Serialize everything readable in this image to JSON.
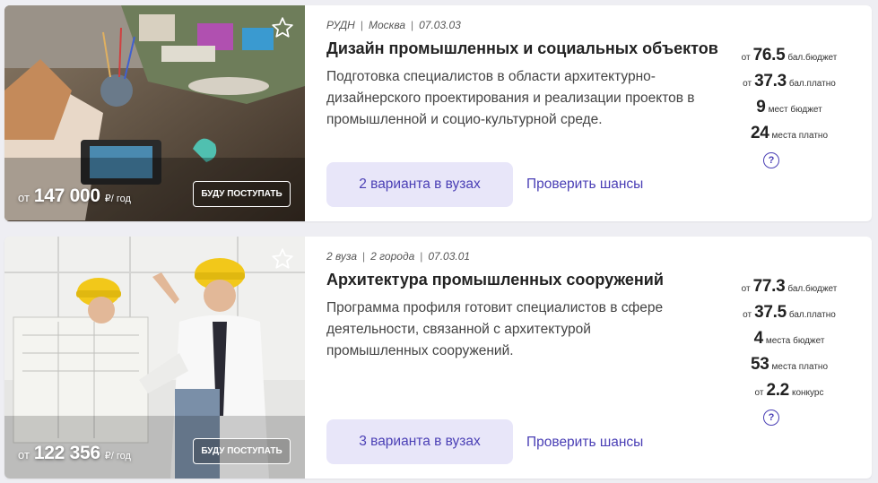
{
  "cards": [
    {
      "price_from": "от",
      "price_amount": "147 000",
      "price_unit": "₽/ год",
      "apply_label": "БУДУ ПОСТУПАТЬ",
      "meta": [
        "РУДН",
        "Москва",
        "07.03.03"
      ],
      "title": "Дизайн промышленных и социальных объектов",
      "description": "Подготовка специалистов в области архитектурно-дизайнерского проектирования и реализации проектов в промышленной и социо-культурной среде.",
      "variants_label": "2 варианта в вузах",
      "chances_label": "Проверить шансы",
      "stats": [
        {
          "pre": "от",
          "num": "76.5",
          "lbl": "бал.бюджет"
        },
        {
          "pre": "от",
          "num": "37.3",
          "lbl": "бал.платно"
        },
        {
          "pre": "",
          "num": "9",
          "lbl": "мест бюджет"
        },
        {
          "pre": "",
          "num": "24",
          "lbl": "места платно"
        }
      ],
      "help": "?"
    },
    {
      "price_from": "от",
      "price_amount": "122 356",
      "price_unit": "₽/ год",
      "apply_label": "БУДУ ПОСТУПАТЬ",
      "meta": [
        "2 вуза",
        "2 города",
        "07.03.01"
      ],
      "title": "Архитектура промышленных сооружений",
      "description": "Программа профиля готовит специалистов в сфере деятельности, связанной с архитектурой промышленных сооружений.",
      "variants_label": "3 варианта в вузах",
      "chances_label": "Проверить шансы",
      "stats": [
        {
          "pre": "от",
          "num": "77.3",
          "lbl": "бал.бюджет"
        },
        {
          "pre": "от",
          "num": "37.5",
          "lbl": "бал.платно"
        },
        {
          "pre": "",
          "num": "4",
          "lbl": "места бюджет"
        },
        {
          "pre": "",
          "num": "53",
          "lbl": "места платно"
        },
        {
          "pre": "от",
          "num": "2.2",
          "lbl": "конкурс"
        }
      ],
      "help": "?"
    }
  ],
  "colors": {
    "accent": "#4a3fb5",
    "button_bg": "#e8e6f9",
    "page_bg": "#eeeef3"
  }
}
